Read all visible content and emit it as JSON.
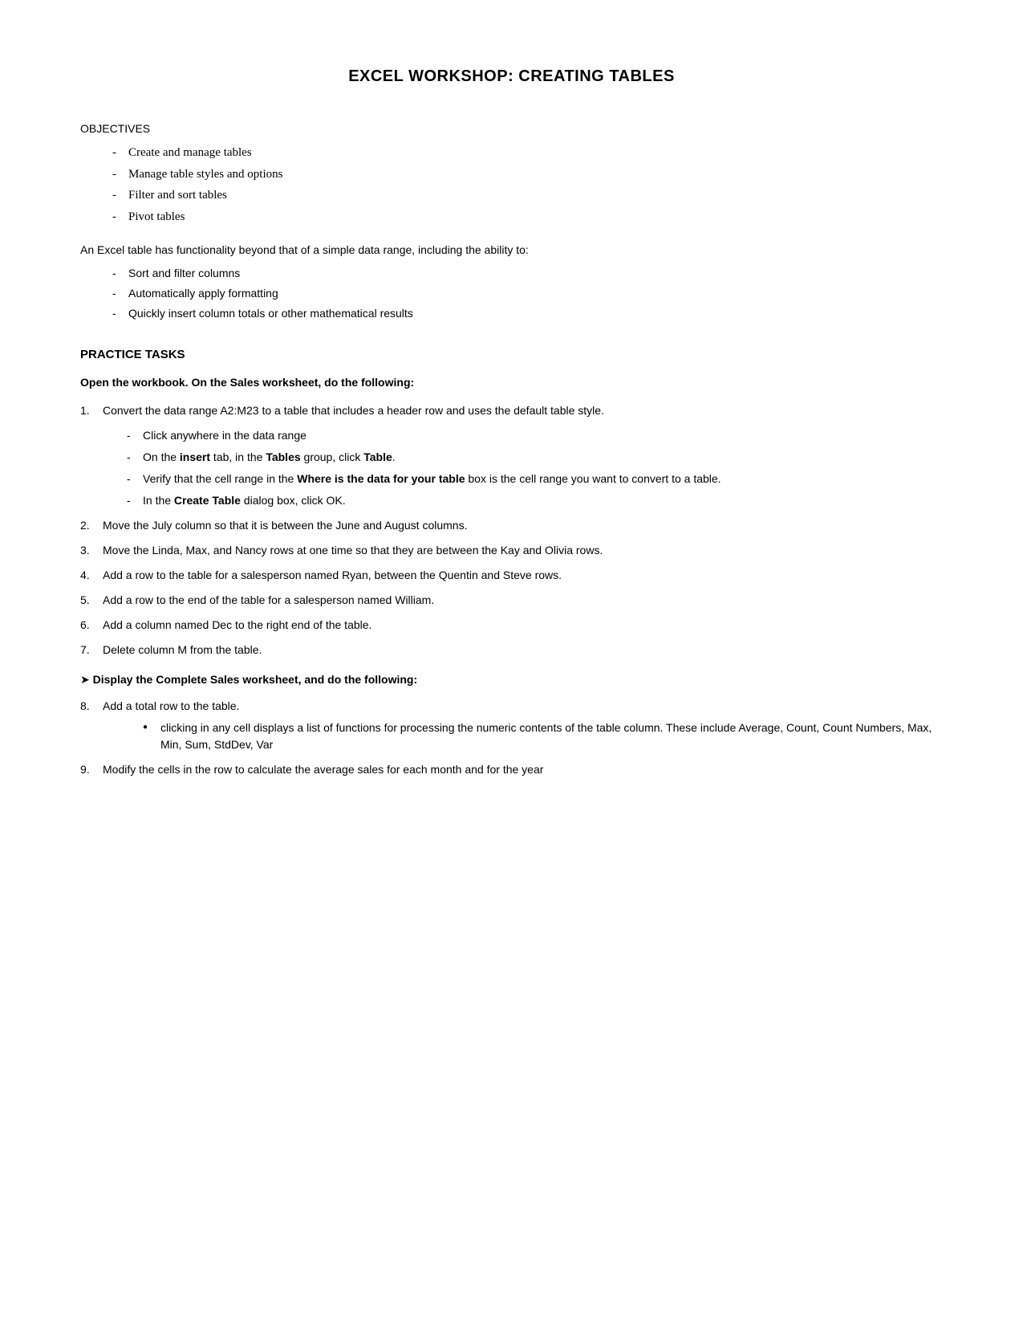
{
  "title": "EXCEL WORKSHOP: CREATING TABLES",
  "sections": {
    "objectives_label": "OBJECTIVES",
    "objectives_items": [
      "Create and manage tables",
      "Manage table styles and options",
      "Filter and sort tables",
      "Pivot tables"
    ],
    "intro": "An Excel table has functionality beyond that of a simple data range, including the ability to:",
    "features": [
      "Sort and filter columns",
      "Automatically apply formatting",
      "Quickly insert column totals or other mathematical results"
    ],
    "practice_tasks": "PRACTICE TASKS",
    "task_heading": "Open the workbook. On the Sales worksheet, do the following:",
    "task1": {
      "main": "Convert the data range A2:M23 to a table that includes a header row and uses the default table style.",
      "steps": [
        "Click anywhere in the data range",
        "On the insert tab, in the Tables group, click Table.",
        "Verify that the cell range in the Where is the data for your table box is the cell range you want to convert to a table.",
        "In the Create Table dialog box, click OK."
      ],
      "steps_bold": [
        false,
        true,
        true,
        true
      ]
    },
    "task2": "Move the July column so that it is between the June and August columns.",
    "task3": "Move the Linda, Max, and Nancy rows at one time so that they are between the Kay and Olivia rows.",
    "task4": "Add a row to the table for a salesperson named Ryan, between the Quentin and Steve rows.",
    "task5": "Add a row to the end of the table for a salesperson named William.",
    "task6": "Add a column named Dec to the right end of the table.",
    "task7": "Delete column M from the table.",
    "display_heading": "➤ Display the Complete Sales worksheet, and do the following:",
    "task8_main": "Add a total row to the table.",
    "task8_bullet": "clicking in any cell displays a list of functions for processing the numeric contents of the table column. These include Average, Count, Count Numbers, Max, Min, Sum, StdDev, Var",
    "task9": "Modify the cells in the row to calculate the average sales for each month and for the year"
  }
}
